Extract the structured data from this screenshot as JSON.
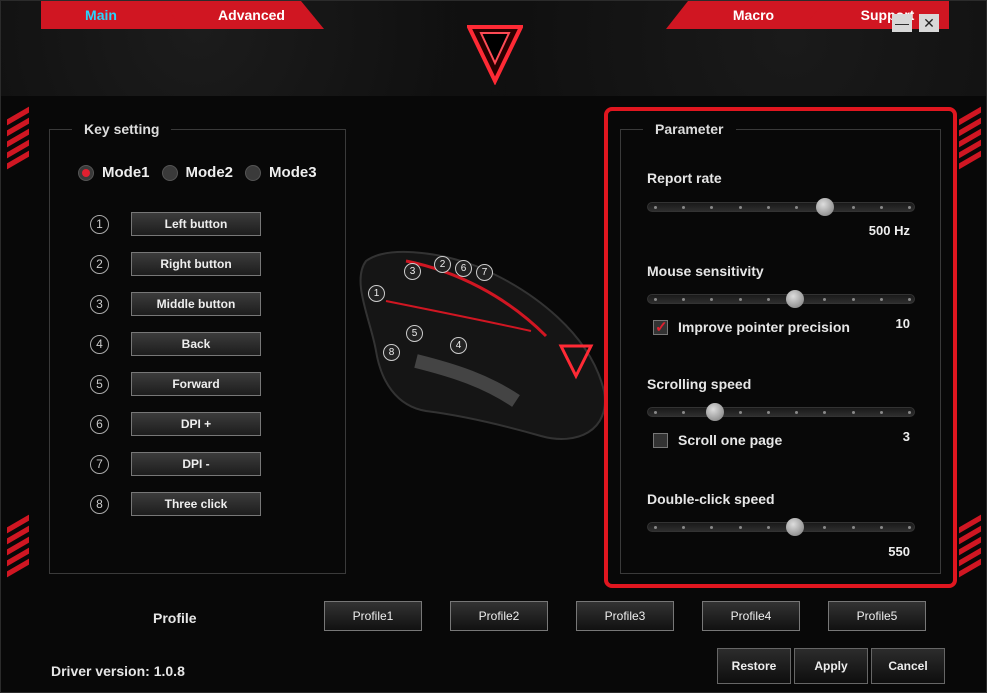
{
  "window": {
    "minimize_glyph": "—",
    "close_glyph": "✕"
  },
  "tabs": {
    "main": "Main",
    "advanced": "Advanced",
    "macro": "Macro",
    "support": "Support"
  },
  "colors": {
    "accent": "#d01622",
    "highlight": "#e0161f",
    "active_tab_text": "#28d4ff"
  },
  "key_setting": {
    "title": "Key setting",
    "modes": [
      {
        "label": "Mode1",
        "selected": true
      },
      {
        "label": "Mode2",
        "selected": false
      },
      {
        "label": "Mode3",
        "selected": false
      }
    ],
    "keys": [
      {
        "num": "1",
        "label": "Left button"
      },
      {
        "num": "2",
        "label": "Right button"
      },
      {
        "num": "3",
        "label": "Middle button"
      },
      {
        "num": "4",
        "label": "Back"
      },
      {
        "num": "5",
        "label": "Forward"
      },
      {
        "num": "6",
        "label": "DPI +"
      },
      {
        "num": "7",
        "label": "DPI -"
      },
      {
        "num": "8",
        "label": "Three click"
      }
    ]
  },
  "mouse_callouts": [
    "1",
    "2",
    "3",
    "4",
    "5",
    "6",
    "7",
    "8"
  ],
  "parameter": {
    "title": "Parameter",
    "report_rate": {
      "label": "Report rate",
      "value": "500 Hz",
      "position": 0.66
    },
    "mouse_sensitivity": {
      "label": "Mouse sensitivity",
      "value": "10",
      "position": 0.55
    },
    "improve_precision": {
      "label": "Improve pointer precision",
      "checked": true
    },
    "scrolling_speed": {
      "label": "Scrolling speed",
      "value": "3",
      "position": 0.25
    },
    "scroll_one_page": {
      "label": "Scroll one page",
      "checked": false
    },
    "double_click": {
      "label": "Double-click speed",
      "value": "550",
      "position": 0.55
    }
  },
  "profiles": {
    "label": "Profile",
    "items": [
      "Profile1",
      "Profile2",
      "Profile3",
      "Profile4",
      "Profile5"
    ],
    "active_index": 0
  },
  "footer": {
    "driver_label": "Driver version:",
    "driver_version": "1.0.8",
    "restore": "Restore",
    "apply": "Apply",
    "cancel": "Cancel"
  }
}
